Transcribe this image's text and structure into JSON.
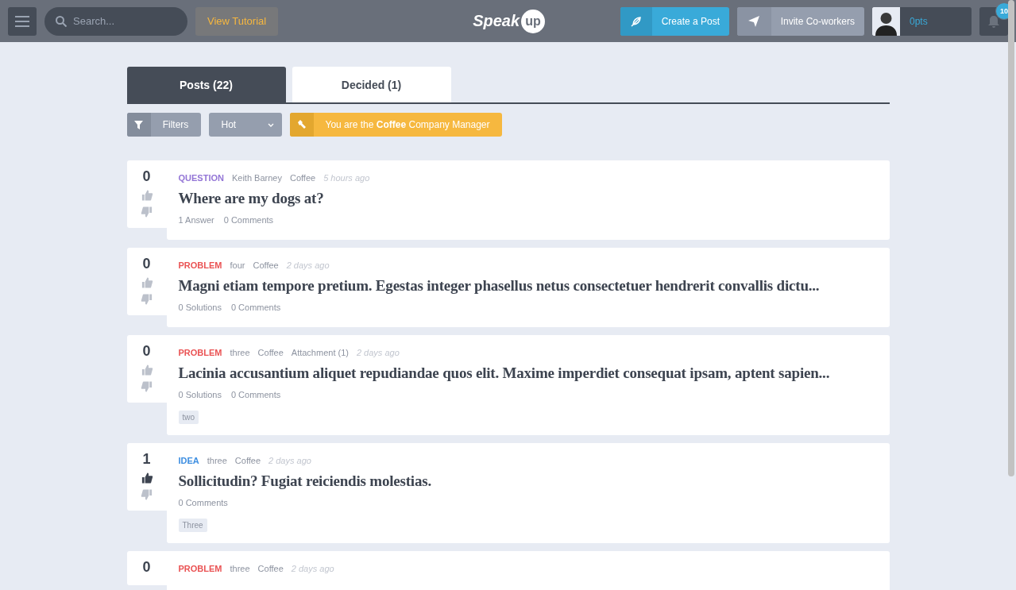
{
  "header": {
    "search": {
      "placeholder": "Search..."
    },
    "tutorial_button": "View Tutorial",
    "logo": {
      "text": "Speak",
      "badge": "up"
    },
    "create_button": "Create a Post",
    "invite_button": "Invite Co-workers",
    "points": "0pts",
    "notifications": "10"
  },
  "tabs": [
    {
      "label": "Posts (22)",
      "selected": true
    },
    {
      "label": "Decided (1)",
      "selected": false
    }
  ],
  "toolbar": {
    "filters_button": "Filters",
    "sort": {
      "value": "Hot"
    },
    "notice": "You are the **Coffee** Company Manager"
  },
  "posts": [
    {
      "score": "0",
      "voted_up": false,
      "kind": "question",
      "type_label": "QUESTION",
      "meta": [
        "Keith Barney",
        "Coffee"
      ],
      "time": "5 hours ago",
      "title": "Where are my dogs at?",
      "stats": [
        "1 Answer",
        "0 Comments"
      ]
    },
    {
      "score": "0",
      "voted_up": false,
      "kind": "problem",
      "type_label": "PROBLEM",
      "meta": [
        "four",
        "Coffee"
      ],
      "time": "2 days ago",
      "title": "Magni etiam tempore pretium. Egestas integer phasellus netus consectetuer hendrerit convallis dictu...",
      "stats": [
        "0 Solutions",
        "0 Comments"
      ]
    },
    {
      "score": "0",
      "voted_up": false,
      "kind": "problem",
      "type_label": "PROBLEM",
      "meta": [
        "three",
        "Coffee",
        "Attachment (1)"
      ],
      "time": "2 days ago",
      "title": "Lacinia accusantium aliquet repudiandae quos elit. Maxime imperdiet consequat ipsam, aptent sapien...",
      "stats": [
        "0 Solutions",
        "0 Comments"
      ],
      "tags": [
        "two"
      ]
    },
    {
      "score": "1",
      "voted_up": true,
      "kind": "idea",
      "type_label": "IDEA",
      "meta": [
        "three",
        "Coffee"
      ],
      "time": "2 days ago",
      "title": "Sollicitudin? Fugiat reiciendis molestias.",
      "stats": [
        "0 Comments"
      ],
      "tags": [
        "Three"
      ]
    },
    {
      "score": "0",
      "kind": "problem",
      "type_label": "PROBLEM",
      "meta": [
        "three",
        "Coffee"
      ],
      "time": "2 days ago"
    }
  ]
}
